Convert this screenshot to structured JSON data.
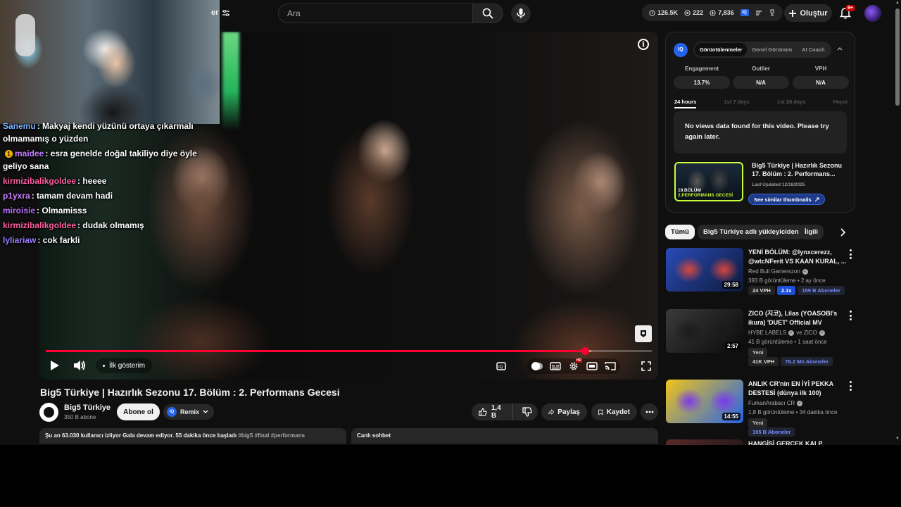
{
  "masthead": {
    "partial_label": "er"
  },
  "search": {
    "placeholder": "Ara"
  },
  "topstats": {
    "views": "126.5K",
    "comments": "222",
    "likes": "7,836"
  },
  "create": {
    "label": "Oluştur"
  },
  "notifications": {
    "badge": "9+"
  },
  "chat": [
    {
      "user": "Sanemu",
      "user_color": "#7db3ff",
      "message": ": Makyaj kendi yüzünü ortaya çıkarmalı olmamamış o yüzden",
      "emote": ""
    },
    {
      "user": "maidee",
      "user_color": "#c77dff",
      "message": ": esra genelde doğal takiliyo diye öyle geliyo sana",
      "emote": "1"
    },
    {
      "user": "kirmizibalikgoldee",
      "user_color": "#ff5fa2",
      "message": ": heeee",
      "emote": ""
    },
    {
      "user": "p1yxra",
      "user_color": "#c77dff",
      "message": ": tamam devam hadi",
      "emote": ""
    },
    {
      "user": "miroisie",
      "user_color": "#b96cff",
      "message": ": Olmamisss",
      "emote": ""
    },
    {
      "user": "kirmizibalikgoldee",
      "user_color": "#ff5fa2",
      "message": ": dudak olmamış",
      "emote": ""
    },
    {
      "user": "lyliariaw",
      "user_color": "#9b7dff",
      "message": ": cok farkli",
      "emote": ""
    }
  ],
  "player": {
    "chapter_label": "İlk gösterim",
    "progress_played": 0.89,
    "progress_buffered": 0.9
  },
  "video": {
    "title": "Big5 Türkiye | Hazırlık Sezonu 17. Bölüm : 2. Performans Gecesi",
    "channel": "Big5 Türkiye",
    "subscribers": "350 B abone",
    "subscribe_label": "Abone ol",
    "remix_label": "Remix",
    "likes": "1,4 B",
    "share_label": "Paylaş",
    "save_label": "Kaydet",
    "description_line": "Şu an 63.030 kullanıcı izliyor  Gala devam ediyor. 55 dakika önce başladı",
    "description_tags": "#big5 #final #performans",
    "live_chat_label": "Canlı sohbet"
  },
  "panel": {
    "tabs": [
      "Görüntülenmeler",
      "Genel Görünüm",
      "AI Coach"
    ],
    "active_tab": "Görüntülenmeler",
    "metrics": [
      {
        "label": "Engagement",
        "value": "13.7%"
      },
      {
        "label": "Outlier",
        "value": "N/A"
      },
      {
        "label": "VPH",
        "value": "N/A"
      }
    ],
    "ranges": [
      "24 hours",
      "1st 7 days",
      "1st 28 days",
      "Hepsi"
    ],
    "no_data": "No views data found for this video. Please try again later.",
    "promo_title": "Big5 Türkiye | Hazırlık Sezonu 17. Bölüm : 2. Performans...",
    "promo_updated": "Last Updated 12/18/2025",
    "promo_thumb_text_top": "19.BÖLÜM",
    "promo_thumb_text": "2.PERFORMANS GECESİ",
    "promo_button": "See similar thumbnails"
  },
  "chips": [
    "Tümü",
    "Big5 Türkiye adlı yükleyiciden",
    "İlgili"
  ],
  "related": [
    {
      "title": "YENİ BÖLÜM: @lynxcerezz, @wtcNFerit VS KAAN KURAL, ...",
      "channel": "Red Bull Gamerszon",
      "meta": "393 B görüntüleme • 2 ay önce",
      "duration": "29:58",
      "badges": [
        "24 VPH",
        "2.1x",
        "159 B Aboneler"
      ],
      "thumb_colors": [
        "#2a4bb8",
        "#d8463c",
        "#0d1a3a"
      ]
    },
    {
      "title": "ZICO (지코), Lilas (YOASOBI's ikura) 'DUET' Official MV",
      "channel": "HYBE LABELS",
      "channel_extra": "ve ZICO",
      "meta": "41 B görüntüleme • 1 saat önce",
      "duration": "2:57",
      "new_label": "Yeni",
      "badges": [
        "41K VPH",
        "79.2 Mn Aboneler"
      ],
      "thumb_colors": [
        "#3a3a3a",
        "#1b1b1b",
        "#0a0a0a"
      ]
    },
    {
      "title": "ANLIK CR'nin EN İYİ PEKKA DESTESİ (dünya ilk 100)",
      "channel": "FurkanArabacı CR",
      "meta": "1,8 B görüntüleme • 34 dakika önce",
      "duration": "14:55",
      "new_label": "Yeni",
      "badges": [
        "195 B Aboneler"
      ],
      "thumb_colors": [
        "#f0c419",
        "#7c3aed",
        "#2563eb"
      ]
    },
    {
      "title": "HANGİSİ GERÇEK KALP KOCASI...",
      "thumb_colors": [
        "#5a2a2a",
        "#333",
        "#111"
      ]
    }
  ]
}
